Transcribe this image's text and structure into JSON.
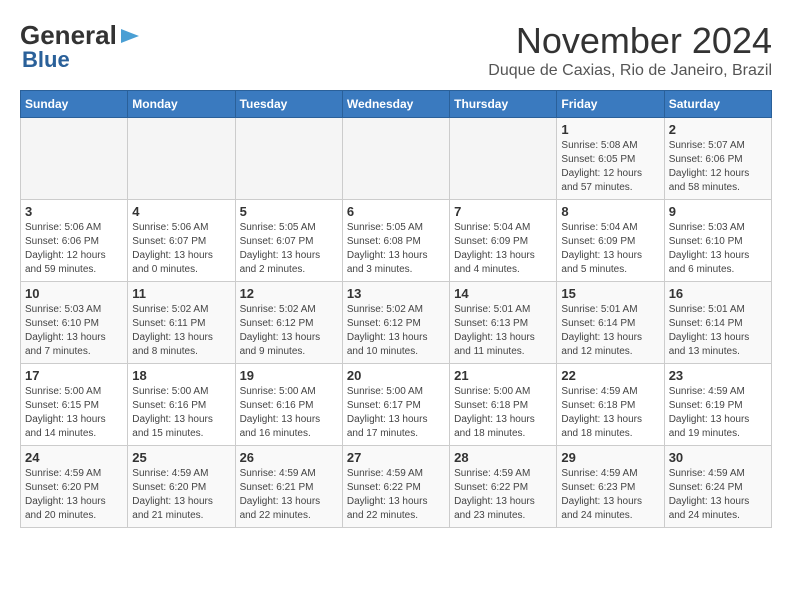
{
  "header": {
    "logo_general": "General",
    "logo_blue": "Blue",
    "month_title": "November 2024",
    "location": "Duque de Caxias, Rio de Janeiro, Brazil"
  },
  "days_of_week": [
    "Sunday",
    "Monday",
    "Tuesday",
    "Wednesday",
    "Thursday",
    "Friday",
    "Saturday"
  ],
  "weeks": [
    [
      {
        "day": "",
        "info": ""
      },
      {
        "day": "",
        "info": ""
      },
      {
        "day": "",
        "info": ""
      },
      {
        "day": "",
        "info": ""
      },
      {
        "day": "",
        "info": ""
      },
      {
        "day": "1",
        "info": "Sunrise: 5:08 AM\nSunset: 6:05 PM\nDaylight: 12 hours and 57 minutes."
      },
      {
        "day": "2",
        "info": "Sunrise: 5:07 AM\nSunset: 6:06 PM\nDaylight: 12 hours and 58 minutes."
      }
    ],
    [
      {
        "day": "3",
        "info": "Sunrise: 5:06 AM\nSunset: 6:06 PM\nDaylight: 12 hours and 59 minutes."
      },
      {
        "day": "4",
        "info": "Sunrise: 5:06 AM\nSunset: 6:07 PM\nDaylight: 13 hours and 0 minutes."
      },
      {
        "day": "5",
        "info": "Sunrise: 5:05 AM\nSunset: 6:07 PM\nDaylight: 13 hours and 2 minutes."
      },
      {
        "day": "6",
        "info": "Sunrise: 5:05 AM\nSunset: 6:08 PM\nDaylight: 13 hours and 3 minutes."
      },
      {
        "day": "7",
        "info": "Sunrise: 5:04 AM\nSunset: 6:09 PM\nDaylight: 13 hours and 4 minutes."
      },
      {
        "day": "8",
        "info": "Sunrise: 5:04 AM\nSunset: 6:09 PM\nDaylight: 13 hours and 5 minutes."
      },
      {
        "day": "9",
        "info": "Sunrise: 5:03 AM\nSunset: 6:10 PM\nDaylight: 13 hours and 6 minutes."
      }
    ],
    [
      {
        "day": "10",
        "info": "Sunrise: 5:03 AM\nSunset: 6:10 PM\nDaylight: 13 hours and 7 minutes."
      },
      {
        "day": "11",
        "info": "Sunrise: 5:02 AM\nSunset: 6:11 PM\nDaylight: 13 hours and 8 minutes."
      },
      {
        "day": "12",
        "info": "Sunrise: 5:02 AM\nSunset: 6:12 PM\nDaylight: 13 hours and 9 minutes."
      },
      {
        "day": "13",
        "info": "Sunrise: 5:02 AM\nSunset: 6:12 PM\nDaylight: 13 hours and 10 minutes."
      },
      {
        "day": "14",
        "info": "Sunrise: 5:01 AM\nSunset: 6:13 PM\nDaylight: 13 hours and 11 minutes."
      },
      {
        "day": "15",
        "info": "Sunrise: 5:01 AM\nSunset: 6:14 PM\nDaylight: 13 hours and 12 minutes."
      },
      {
        "day": "16",
        "info": "Sunrise: 5:01 AM\nSunset: 6:14 PM\nDaylight: 13 hours and 13 minutes."
      }
    ],
    [
      {
        "day": "17",
        "info": "Sunrise: 5:00 AM\nSunset: 6:15 PM\nDaylight: 13 hours and 14 minutes."
      },
      {
        "day": "18",
        "info": "Sunrise: 5:00 AM\nSunset: 6:16 PM\nDaylight: 13 hours and 15 minutes."
      },
      {
        "day": "19",
        "info": "Sunrise: 5:00 AM\nSunset: 6:16 PM\nDaylight: 13 hours and 16 minutes."
      },
      {
        "day": "20",
        "info": "Sunrise: 5:00 AM\nSunset: 6:17 PM\nDaylight: 13 hours and 17 minutes."
      },
      {
        "day": "21",
        "info": "Sunrise: 5:00 AM\nSunset: 6:18 PM\nDaylight: 13 hours and 18 minutes."
      },
      {
        "day": "22",
        "info": "Sunrise: 4:59 AM\nSunset: 6:18 PM\nDaylight: 13 hours and 18 minutes."
      },
      {
        "day": "23",
        "info": "Sunrise: 4:59 AM\nSunset: 6:19 PM\nDaylight: 13 hours and 19 minutes."
      }
    ],
    [
      {
        "day": "24",
        "info": "Sunrise: 4:59 AM\nSunset: 6:20 PM\nDaylight: 13 hours and 20 minutes."
      },
      {
        "day": "25",
        "info": "Sunrise: 4:59 AM\nSunset: 6:20 PM\nDaylight: 13 hours and 21 minutes."
      },
      {
        "day": "26",
        "info": "Sunrise: 4:59 AM\nSunset: 6:21 PM\nDaylight: 13 hours and 22 minutes."
      },
      {
        "day": "27",
        "info": "Sunrise: 4:59 AM\nSunset: 6:22 PM\nDaylight: 13 hours and 22 minutes."
      },
      {
        "day": "28",
        "info": "Sunrise: 4:59 AM\nSunset: 6:22 PM\nDaylight: 13 hours and 23 minutes."
      },
      {
        "day": "29",
        "info": "Sunrise: 4:59 AM\nSunset: 6:23 PM\nDaylight: 13 hours and 24 minutes."
      },
      {
        "day": "30",
        "info": "Sunrise: 4:59 AM\nSunset: 6:24 PM\nDaylight: 13 hours and 24 minutes."
      }
    ]
  ]
}
